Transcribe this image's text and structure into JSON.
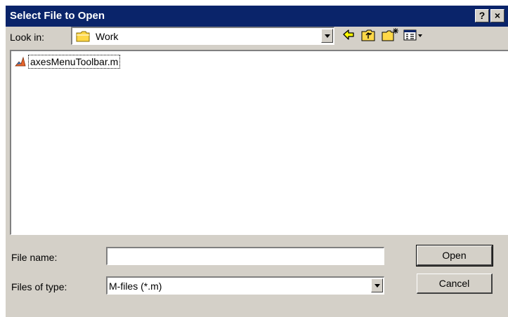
{
  "window": {
    "title": "Select File to Open",
    "help_label": "?",
    "close_label": "×"
  },
  "toolbar": {
    "look_in_label": "Look in:",
    "look_in_value": "Work",
    "icons": [
      "back-arrow-icon",
      "up-folder-icon",
      "new-folder-icon",
      "view-menu-icon"
    ]
  },
  "files": [
    {
      "name": "axesMenuToolbar.m",
      "icon": "matlab-file-icon"
    }
  ],
  "form": {
    "file_name_label": "File name:",
    "file_name_value": "",
    "file_type_label": "Files of type:",
    "file_type_value": "M-files (*.m)"
  },
  "buttons": {
    "open": "Open",
    "cancel": "Cancel"
  },
  "colors": {
    "title_bar": "#0a246a",
    "dialog_bg": "#d4d0c8",
    "folder_yellow": "#ffd848",
    "arrow_yellow": "#ffff00"
  }
}
